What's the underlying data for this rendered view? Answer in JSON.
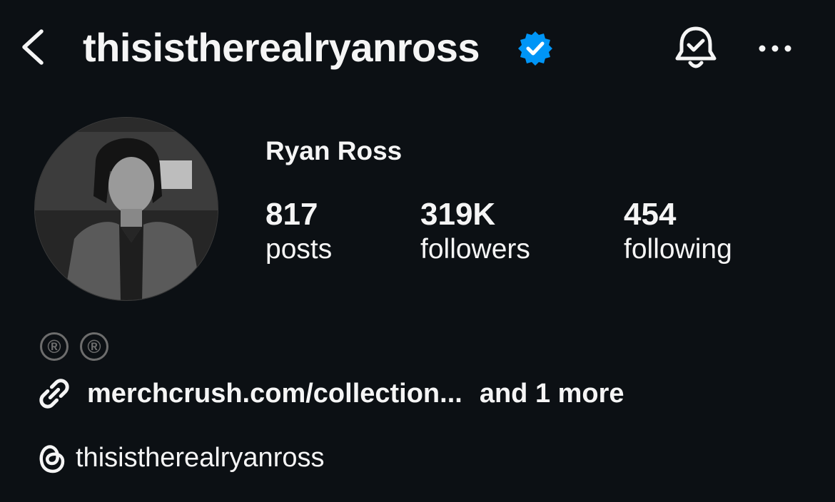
{
  "header": {
    "username": "thisistherealryanross",
    "back_icon": "chevron-left-icon",
    "verified_icon": "verified-badge-icon",
    "verified_color": "#0095f6",
    "bell_icon": "bell-check-icon",
    "more_icon": "more-horizontal-icon"
  },
  "profile": {
    "display_name": "Ryan Ross",
    "stats": {
      "posts": {
        "value": "817",
        "label": "posts"
      },
      "followers": {
        "value": "319K",
        "label": "followers"
      },
      "following": {
        "value": "454",
        "label": "following"
      }
    },
    "badges": [
      "®",
      "®"
    ],
    "link": {
      "icon": "link-icon",
      "text": "merchcrush.com/collection...",
      "more": "and 1 more"
    },
    "threads": {
      "icon": "threads-icon",
      "handle": "thisistherealryanross"
    }
  },
  "colors": {
    "background": "#0c1014",
    "text": "#f5f5f5",
    "badge": "#6d6d6d"
  }
}
